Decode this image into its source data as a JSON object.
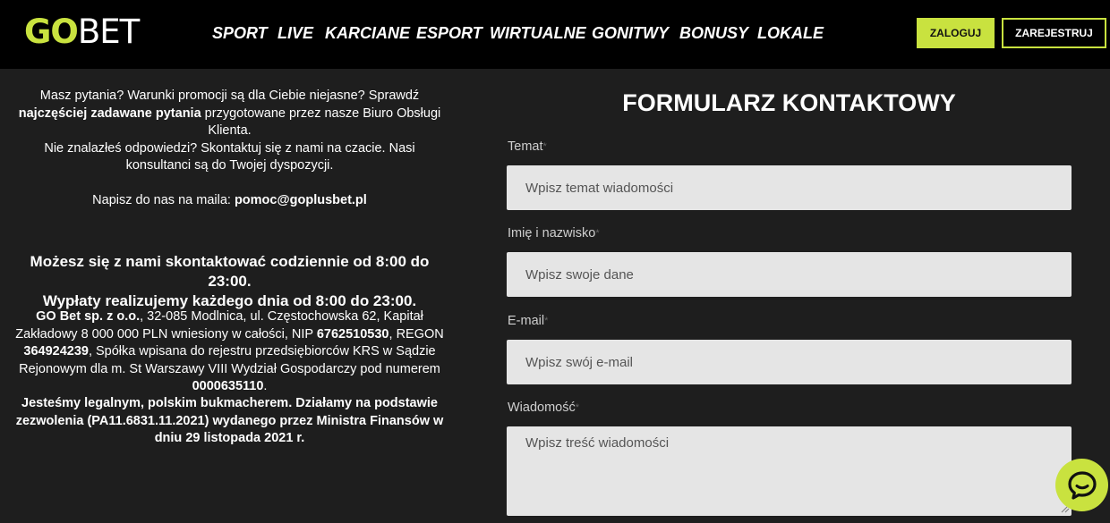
{
  "brand": {
    "go": "GO",
    "bet": "BET"
  },
  "nav": [
    "SPORT",
    "LIVE",
    "KARCIANE",
    "ESPORT",
    "WIRTUALNE",
    "GONITWY",
    "BONUSY",
    "LOKALE"
  ],
  "header": {
    "login_label": "ZALOGUJ",
    "register_label": "ZAREJESTRUJ"
  },
  "info": {
    "p1_a": "Masz pytania? Warunki promocji są dla Ciebie niejasne?  Sprawdź ",
    "p1_b": "najczęściej zadawane pytania",
    "p1_c": " przygotowane przez nasze Biuro Obsługi Klienta.",
    "p1_d": "Nie znalazłeś odpowiedzi? Skontaktuj się z nami na czacie. Nasi konsultanci są do Twojej dyspozycji.",
    "mail_prefix": "Napisz do nas na maila: ",
    "mail": "pomoc@goplusbet.pl",
    "hours_1": "Możesz się z nami skontaktować codziennie od 8:00 do 23:00.",
    "hours_2": "Wypłaty realizujemy każdego dnia od 8:00 do 23:00.",
    "company_name": "GO Bet sp. z o.o.",
    "company_a": ", 32-085 Modlnica, ul. Częstochowska 62, Kapitał Zakładowy 8 000 000 PLN wniesiony w całości, NIP ",
    "nip": "6762510530",
    "company_b": ", REGON ",
    "regon": "364924239",
    "company_c": ", Spółka wpisana do rejestru przedsiębiorców KRS w Sądzie Rejonowym dla m. St Warszawy VIII Wydział Gospodarczy pod numerem ",
    "krs": "0000635110",
    "company_d": ".",
    "legal": "Jesteśmy legalnym, polskim bukmacherem. Działamy na podstawie zezwolenia (PA11.6831.11.2021) wydanego przez Ministra Finansów w dniu 29 listopada 2021 r."
  },
  "form": {
    "title": "FORMULARZ KONTAKTOWY",
    "required_mark": "*",
    "subject_label": "Temat",
    "subject_placeholder": "Wpisz temat wiadomości",
    "name_label": "Imię i nazwisko",
    "name_placeholder": "Wpisz swoje dane",
    "email_label": "E-mail",
    "email_placeholder": "Wpisz swój e-mail",
    "message_label": "Wiadomość",
    "message_placeholder": "Wpisz treść wiadomości"
  },
  "icons": {
    "chat": "chat-bubble-icon",
    "resize": "resize-grip-icon"
  },
  "colors": {
    "accent": "#c9e23f",
    "background": "#1e1e1e",
    "header": "#000000",
    "field": "#e5e5e5"
  }
}
